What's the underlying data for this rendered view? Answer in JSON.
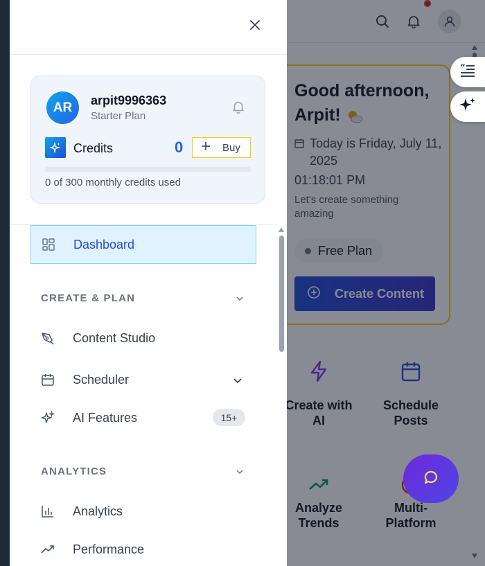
{
  "drawer": {
    "close_icon": "close-icon",
    "profile": {
      "initials": "AR",
      "username": "arpit9996363",
      "plan": "Starter Plan",
      "credits_label": "Credits",
      "credits_count": "0",
      "buy_label": "Buy",
      "credits_used_fraction": 0,
      "usage_text": "0 of 300 monthly credits used"
    },
    "nav": {
      "dashboard": "Dashboard",
      "section_create": "CREATE & PLAN",
      "content_studio": "Content Studio",
      "scheduler": "Scheduler",
      "ai_features": "AI Features",
      "ai_features_badge": "15+",
      "section_analytics": "ANALYTICS",
      "analytics": "Analytics",
      "performance": "Performance"
    }
  },
  "background": {
    "greeting": "Good afternoon, Arpit!",
    "date_text": "Today is Friday, July 11, 2025",
    "time_text": "01:18:01 PM",
    "subtext": "Let's create something amazing",
    "plan_pill": "Free Plan",
    "create_button": "Create Content",
    "tiles": {
      "create_ai": "Create with AI",
      "schedule_posts": "Schedule Posts",
      "analyze_trends": "Analyze Trends",
      "multi_platform": "Multi-Platform"
    }
  },
  "colors": {
    "accent": "#2563eb",
    "active_nav_bg": "#e0f2fe",
    "highlight_border": "#facc15",
    "chat_fab": "#6d28d9"
  }
}
